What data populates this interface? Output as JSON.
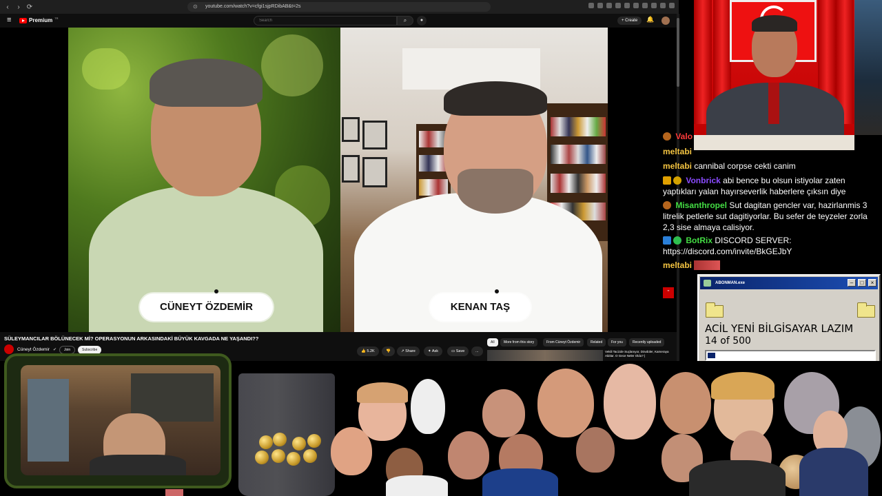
{
  "browser": {
    "url": "youtube.com/watch?v=cfgi1sjpRDibAB&t=2s",
    "back_icon": "back-arrow-icon",
    "forward_icon": "forward-arrow-icon",
    "reload_icon": "reload-icon"
  },
  "youtube": {
    "logo_text": "Premium",
    "logo_sup": "TR",
    "search_placeholder": "Search",
    "create_label": "+ Create"
  },
  "video": {
    "left_name": "CÜNEYT ÖZDEMİR",
    "right_name": "KENAN TAŞ",
    "title": "SÜLEYMANCILAR BÖLÜNECEK Mİ? OPERASYONUN ARKASINDAKİ BÜYÜK KAVGADA NE YAŞANDI??",
    "channel": "Cüneyt Özdemir",
    "join_label": "Join",
    "subscribe_label": "Subscribe",
    "likes": "5.2K",
    "share_label": "Share",
    "ask_label": "Ask",
    "save_label": "Save",
    "more_label": "..."
  },
  "chips": [
    "All",
    "More from this story",
    "From Cüneyt Özdemir",
    "Related",
    "For you",
    "Recently uploaded"
  ],
  "related": {
    "title": "Vekili Tacizde Suçlanıyor, Dövdüler, Kameraya Aldılar. O Gece Neler Oldu? |"
  },
  "chat": [
    {
      "user": "Valo",
      "text": "",
      "user_color": "#ff3b3b"
    },
    {
      "user": "meltabi",
      "text": "",
      "user_color": "#f5c542"
    },
    {
      "user": "meltabi",
      "text": "cannibal corpse cekti canim",
      "user_color": "#f5c542"
    },
    {
      "user": "Vonbrick",
      "text": "abi bence bu olsun istiyolar zaten yaptıkları yalan hayırseverlik haberlere çıksın diye",
      "user_color": "#8a4bff"
    },
    {
      "user": "Misanthropel",
      "text": "Sut dagitan gencler var, hazirlanmis 3 litrelik petlerle sut dagitiyorlar. Bu sefer de teyzeler zorla 2,3 sise almaya calisiyor.",
      "user_color": "#44dd44"
    },
    {
      "user": "BotRix",
      "text": "DISCORD SERVER: https://discord.com/invite/BkGEJbY",
      "user_color": "#44dd44"
    },
    {
      "user": "meltabi",
      "text": "",
      "user_color": "#f5c542"
    }
  ],
  "retro_window": {
    "title": "ABONMAN.exe",
    "message": "ACİL YENİ BİLGİSAYAR LAZIM",
    "count_text": "14 of 500",
    "progress": 0.028
  }
}
